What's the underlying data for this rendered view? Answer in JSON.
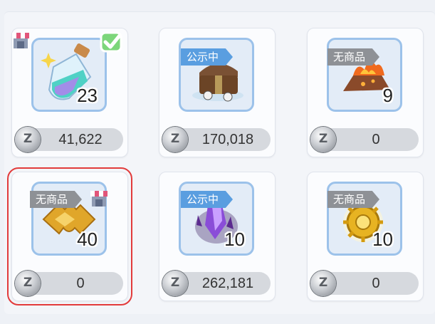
{
  "items": [
    {
      "count": "23",
      "price": "41,622",
      "tag": "",
      "has_shop": true,
      "checked": true,
      "art": "potion"
    },
    {
      "count": "",
      "price": "170,018",
      "tag": "公示中",
      "has_shop": false,
      "checked": false,
      "art": "chest"
    },
    {
      "count": "9",
      "price": "0",
      "tag": "无商品",
      "has_shop": false,
      "checked": false,
      "art": "ore"
    },
    {
      "count": "40",
      "price": "0",
      "tag": "无商品",
      "has_shop": true,
      "checked": false,
      "art": "puzzle",
      "selected": true
    },
    {
      "count": "10",
      "price": "262,181",
      "tag": "公示中",
      "has_shop": false,
      "checked": false,
      "art": "crystal"
    },
    {
      "count": "10",
      "price": "0",
      "tag": "无商品",
      "has_shop": false,
      "checked": false,
      "art": "gear"
    }
  ],
  "colors": {
    "selection": "#e23b3b",
    "tag_notice": "#5a9ee0",
    "tag_none": "#8e9196",
    "icon_border": "#9cc2ea"
  }
}
